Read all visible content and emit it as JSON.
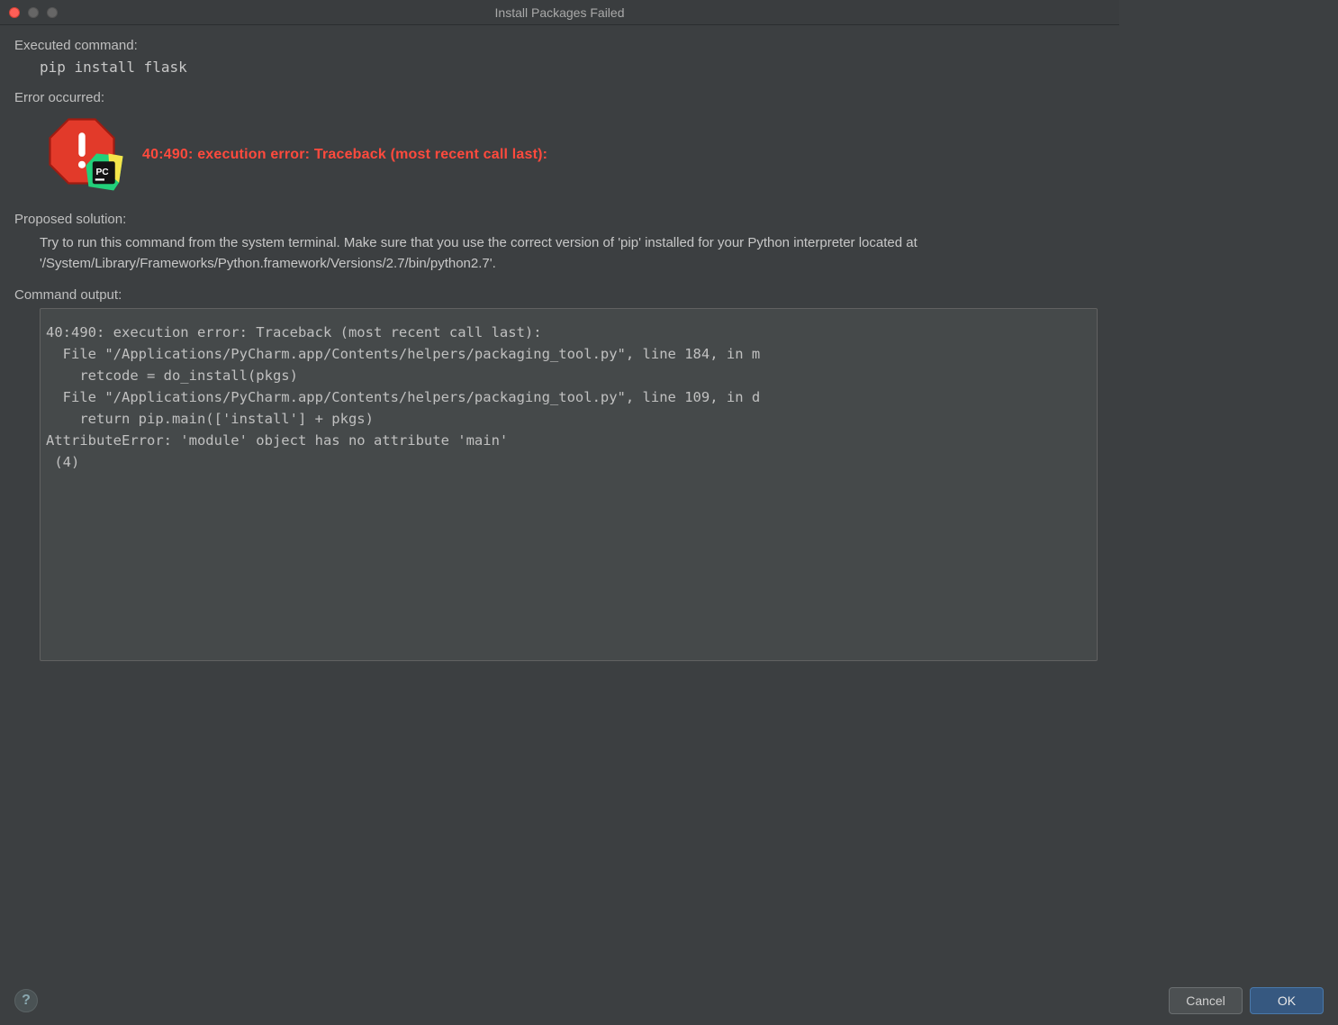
{
  "window": {
    "title": "Install Packages Failed"
  },
  "sections": {
    "executed_label": "Executed command:",
    "executed_value": "pip install flask",
    "error_label": "Error occurred:",
    "error_message": "40:490: execution error: Traceback (most recent call last):",
    "solution_label": "Proposed solution:",
    "solution_text": "Try to run this command from the system terminal. Make sure that you use the correct version of 'pip' installed for your Python interpreter located at '/System/Library/Frameworks/Python.framework/Versions/2.7/bin/python2.7'.",
    "output_label": "Command output:",
    "output_text": "40:490: execution error: Traceback (most recent call last):\n  File \"/Applications/PyCharm.app/Contents/helpers/packaging_tool.py\", line 184, in m\n    retcode = do_install(pkgs)\n  File \"/Applications/PyCharm.app/Contents/helpers/packaging_tool.py\", line 109, in d\n    return pip.main(['install'] + pkgs)\nAttributeError: 'module' object has no attribute 'main'\n (4)"
  },
  "icons": {
    "stop_name": "stop-octagon-icon",
    "app_badge_label": "PC"
  },
  "buttons": {
    "help": "?",
    "cancel": "Cancel",
    "ok": "OK"
  }
}
